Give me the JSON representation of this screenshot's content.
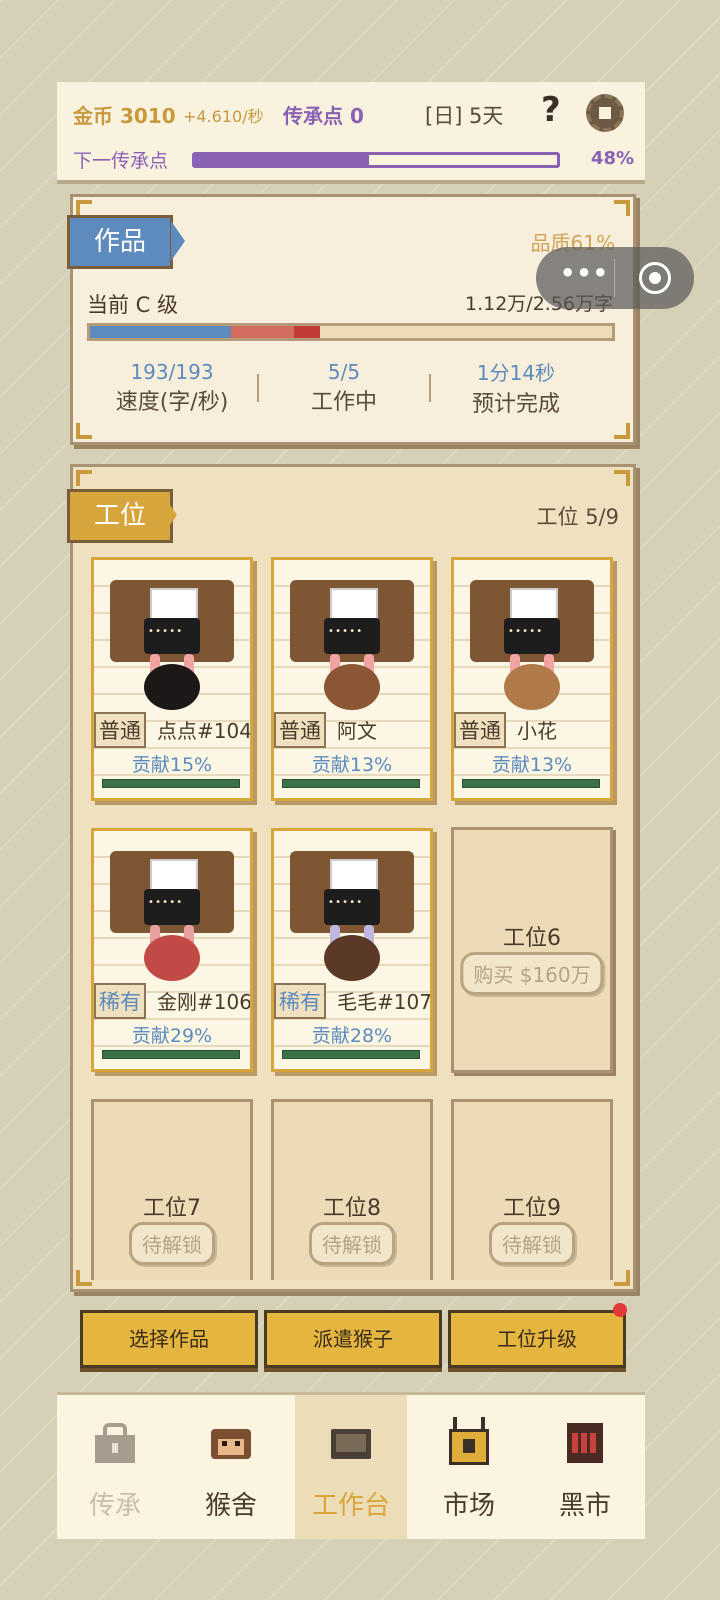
{
  "header": {
    "gold": "金币 3010",
    "gold_rate": "+4.610/秒",
    "legacy_points": "传承点 0",
    "day": "[日] 5天",
    "help": "?",
    "next_legacy_label": "下一传承点",
    "next_legacy_progress": 0.48,
    "next_legacy_pct": "48%"
  },
  "work": {
    "tag": "作品",
    "quality": "品质61%",
    "current_grade": "当前 C 级",
    "words": "1.12万/2.56万字",
    "progress_segments": [
      0.27,
      0.12,
      0.05
    ],
    "stats": [
      {
        "value": "193/193",
        "label": "速度(字/秒)"
      },
      {
        "value": "5/5",
        "label": "工作中"
      },
      {
        "value": "1分14秒",
        "label": "预计完成"
      }
    ]
  },
  "stations": {
    "tag": "工位",
    "count": "工位 5/9",
    "workers": [
      {
        "rarity": "普通",
        "name": "点点#104",
        "contrib": "贡献15%",
        "fur": "#1c1818",
        "nose": "#f2a3a3"
      },
      {
        "rarity": "普通",
        "name": "阿文",
        "contrib": "贡献13%",
        "fur": "#8a5634",
        "nose": "#f2a3a3"
      },
      {
        "rarity": "普通",
        "name": "小花",
        "contrib": "贡献13%",
        "fur": "#b07a48",
        "nose": "#f2a3a3"
      },
      {
        "rarity": "稀有",
        "name": "金刚#106",
        "contrib": "贡献29%",
        "fur": "#c24a45",
        "nose": "#e8a0a0"
      },
      {
        "rarity": "稀有",
        "name": "毛毛#107",
        "contrib": "贡献28%",
        "fur": "#5a3a26",
        "nose": "#c0b8e0"
      }
    ],
    "slot6": {
      "title": "工位6",
      "button": "购买 $160万"
    },
    "locked": [
      {
        "title": "工位7",
        "button": "待解锁"
      },
      {
        "title": "工位8",
        "button": "待解锁"
      },
      {
        "title": "工位9",
        "button": "待解锁"
      }
    ]
  },
  "actions": [
    "选择作品",
    "派遣猴子",
    "工位升级"
  ],
  "nav": [
    {
      "label": "传承",
      "icon": "lock-icon"
    },
    {
      "label": "猴舍",
      "icon": "monkey-icon"
    },
    {
      "label": "工作台",
      "icon": "desk-icon"
    },
    {
      "label": "市场",
      "icon": "market-icon"
    },
    {
      "label": "黑市",
      "icon": "black-market-icon"
    }
  ],
  "nav_active": 2
}
